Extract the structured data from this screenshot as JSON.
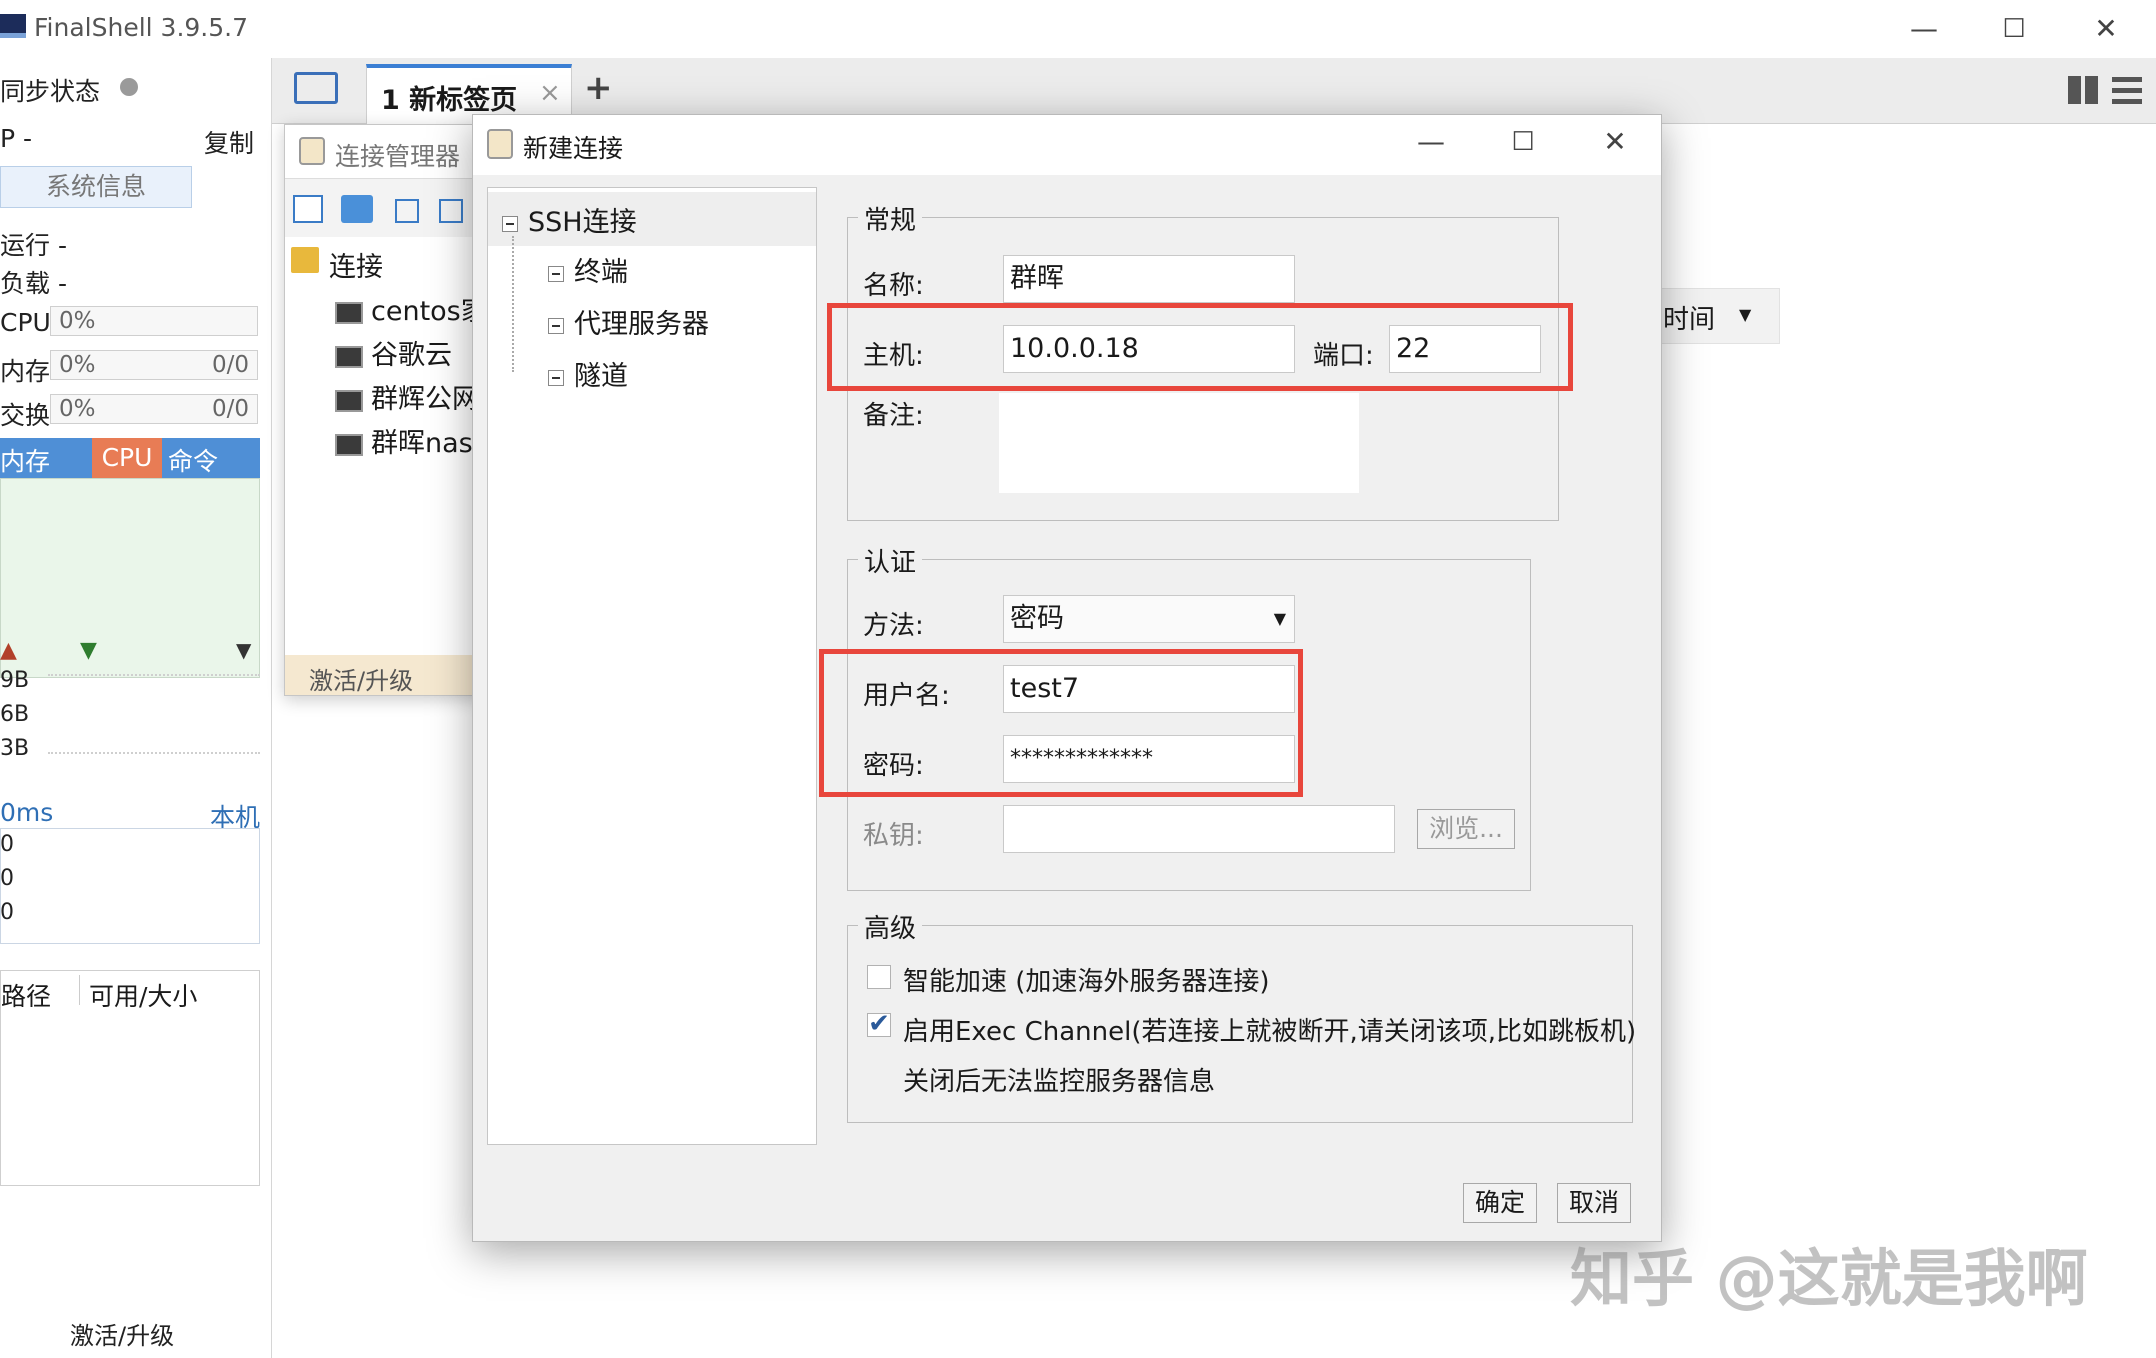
{
  "app": {
    "title": "FinalShell 3.9.5.7"
  },
  "sidebar": {
    "sync_label": "同步状态",
    "ip_label": "P  -",
    "copy_label": "复制",
    "sysinfo_button": "系统信息",
    "run_label": "运行 -",
    "load_label": "负载 -",
    "cpu": {
      "label": "CPU",
      "value": "0%"
    },
    "mem": {
      "label": "内存",
      "value": "0%",
      "ratio": "0/0"
    },
    "swap": {
      "label": "交换",
      "value": "0%",
      "ratio": "0/0"
    },
    "tabs": [
      "内存",
      "CPU",
      "命令"
    ],
    "net_values": [
      "9B",
      "6B",
      "3B"
    ],
    "ping": {
      "label": "0ms",
      "host": "本机",
      "values": [
        "0",
        "0",
        "0"
      ]
    },
    "disk_headers": [
      "路径",
      "可用/大小"
    ],
    "activate": "激活/升级"
  },
  "tabs": {
    "active_tab": "1 新标签页",
    "close_symbol": "×",
    "add_symbol": "+"
  },
  "conn_manager": {
    "title": "连接管理器",
    "root": "连接",
    "items": [
      "centos家",
      "谷歌云",
      "群辉公网",
      "群晖nas"
    ],
    "activate": "激活/升级"
  },
  "behind": {
    "time_dropdown": "时间"
  },
  "dialog": {
    "title": "新建连接",
    "tree": {
      "root": "SSH连接",
      "children": [
        "终端",
        "代理服务器",
        "隧道"
      ]
    },
    "general": {
      "title": "常规",
      "name_label": "名称:",
      "name_value": "群晖",
      "host_label": "主机:",
      "host_value": "10.0.0.18",
      "port_label": "端口:",
      "port_value": "22",
      "note_label": "备注:"
    },
    "auth": {
      "title": "认证",
      "method_label": "方法:",
      "method_value": "密码",
      "user_label": "用户名:",
      "user_value": "test7",
      "pass_label": "密码:",
      "pass_value": "*************",
      "key_label": "私钥:",
      "browse": "浏览..."
    },
    "advanced": {
      "title": "高级",
      "smart_accel": "智能加速 (加速海外服务器连接)",
      "exec_channel": "启用Exec Channel(若连接上就被断开,请关闭该项,比如跳板机)",
      "exec_note": "关闭后无法监控服务器信息",
      "smart_checked": false,
      "exec_checked": true
    },
    "ok": "确定",
    "cancel": "取消"
  },
  "watermark": "知乎 @这就是我啊"
}
